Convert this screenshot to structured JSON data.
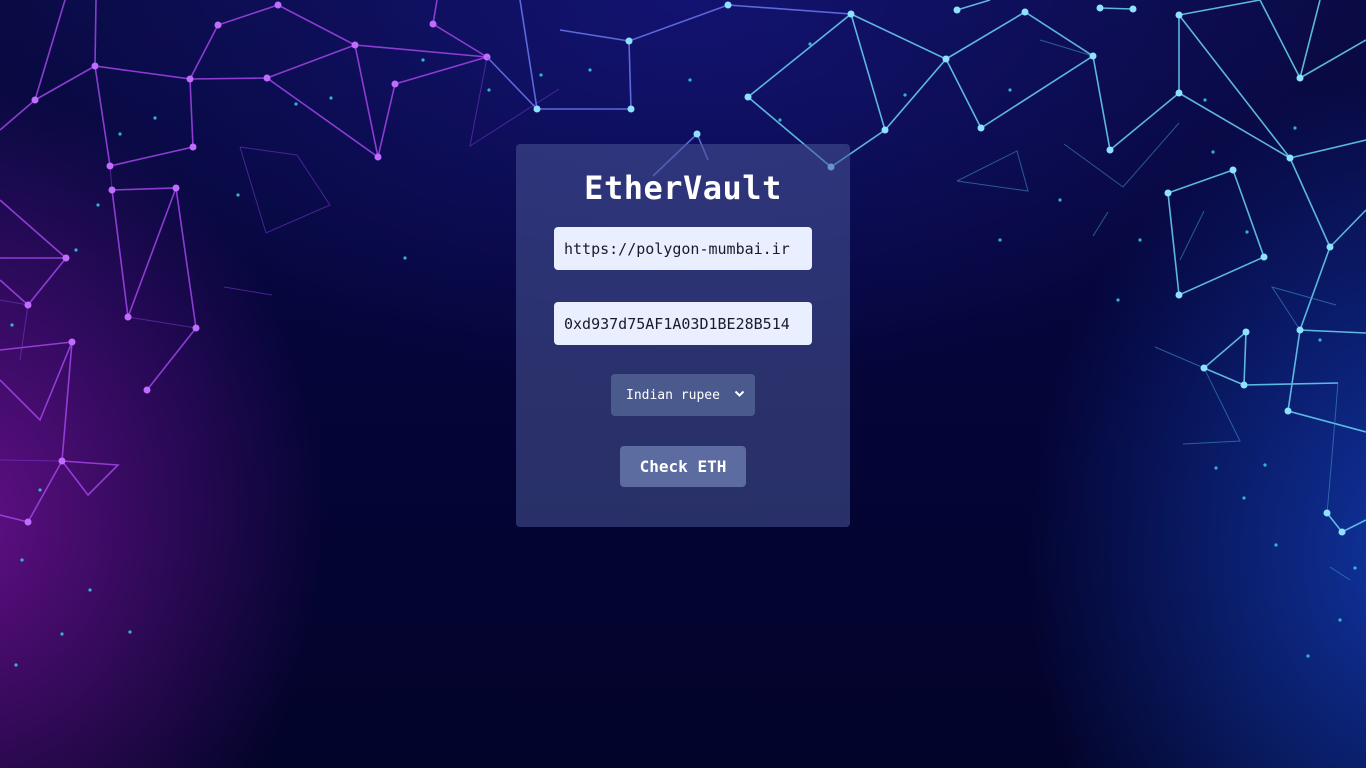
{
  "app": {
    "title": "EtherVault"
  },
  "form": {
    "rpc_url_value": "https://polygon-mumbai.ir",
    "address_value": "0xd937d75AF1A03D1BE28B514",
    "currency_selected": "Indian rupee",
    "submit_label": "Check ETH"
  },
  "icons": {
    "select_arrow": "chevron-down-icon"
  },
  "colors": {
    "card_bg": "#48569a",
    "button_bg": "#5d6ca0",
    "select_bg": "#4b5a8c",
    "input_bg": "#e9efff",
    "network_left": "#b04ef0",
    "network_right": "#6cd4f5"
  }
}
